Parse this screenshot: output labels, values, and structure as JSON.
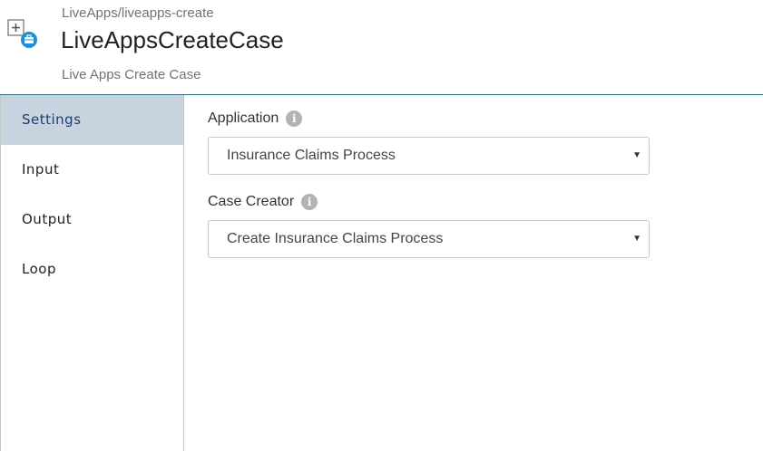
{
  "header": {
    "breadcrumb": "LiveApps/liveapps-create",
    "title": "LiveAppsCreateCase",
    "subtitle": "Live Apps Create Case",
    "icon": "add-case-icon"
  },
  "sidebar": {
    "items": [
      {
        "label": "Settings",
        "active": true
      },
      {
        "label": "Input",
        "active": false
      },
      {
        "label": "Output",
        "active": false
      },
      {
        "label": "Loop",
        "active": false
      }
    ]
  },
  "settings": {
    "application": {
      "label": "Application",
      "value": "Insurance Claims Process",
      "info_icon": "info-icon"
    },
    "case_creator": {
      "label": "Case Creator",
      "value": "Create Insurance Claims Process",
      "info_icon": "info-icon"
    }
  },
  "colors": {
    "accent": "#2e6f85",
    "active_tab_bg": "#c8d3e0",
    "active_tab_text": "#1c3d6e"
  }
}
